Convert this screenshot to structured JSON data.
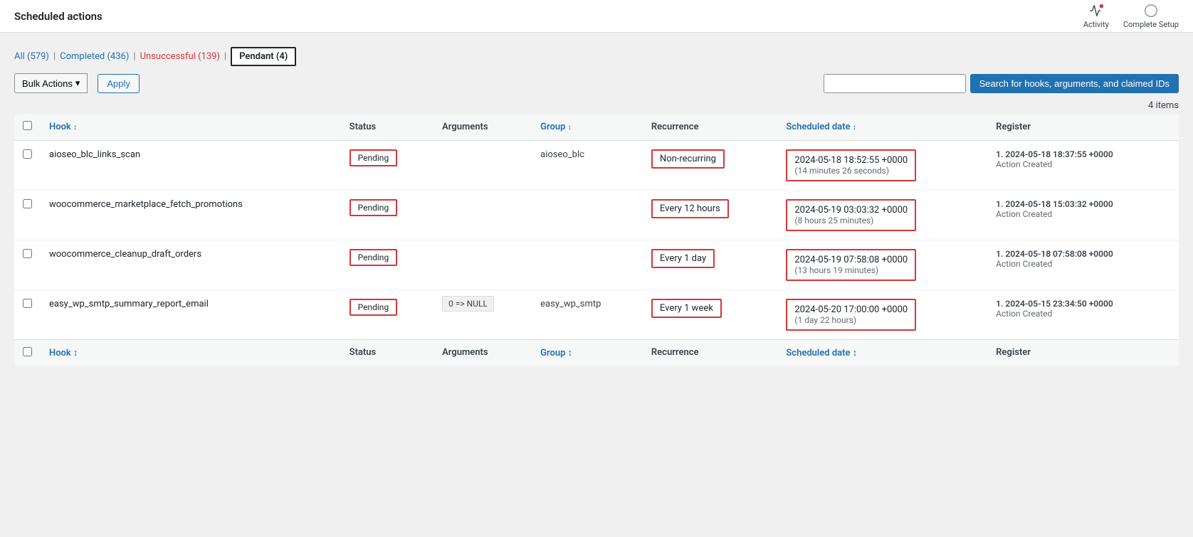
{
  "topbar": {
    "title": "Scheduled actions",
    "activity_label": "Activity",
    "complete_setup_label": "Complete Setup"
  },
  "tabs": {
    "all_label": "All",
    "all_count": "(579)",
    "completed_label": "Completed",
    "completed_count": "(436)",
    "unsuccessful_label": "Unsuccessful",
    "unsuccessful_count": "(139)",
    "pending_label": "Pendant",
    "pending_count": "(4)"
  },
  "toolbar": {
    "bulk_actions_label": "Bulk Actions",
    "apply_label": "Apply",
    "search_placeholder": "",
    "search_button_label": "Search for hooks, arguments, and claimed IDs",
    "items_count": "4 items"
  },
  "columns": {
    "hook": "Hook",
    "status": "Status",
    "arguments": "Arguments",
    "group": "Group",
    "recurrence": "Recurrence",
    "scheduled_date": "Scheduled date",
    "register": "Register"
  },
  "rows": [
    {
      "hook": "aioseo_blc_links_scan",
      "status": "Pending",
      "arguments": "",
      "group": "aioseo_blc",
      "recurrence": "Non-recurring",
      "scheduled_date_main": "2024-05-18 18:52:55 +0000",
      "scheduled_date_relative": "(14 minutes 26 seconds)",
      "register_num": "1.",
      "register_date": "2024-05-18 18:37:55 +0000",
      "register_label": "Action Created"
    },
    {
      "hook": "woocommerce_marketplace_fetch_promotions",
      "status": "Pending",
      "arguments": "",
      "group": "",
      "recurrence": "Every 12 hours",
      "scheduled_date_main": "2024-05-19 03:03:32 +0000",
      "scheduled_date_relative": "(8 hours 25 minutes)",
      "register_num": "1.",
      "register_date": "2024-05-18 15:03:32 +0000",
      "register_label": "Action Created"
    },
    {
      "hook": "woocommerce_cleanup_draft_orders",
      "status": "Pending",
      "arguments": "",
      "group": "",
      "recurrence": "Every 1 day",
      "scheduled_date_main": "2024-05-19 07:58:08 +0000",
      "scheduled_date_relative": "(13 hours 19 minutes)",
      "register_num": "1.",
      "register_date": "2024-05-18 07:58:08 +0000",
      "register_label": "Action Created"
    },
    {
      "hook": "easy_wp_smtp_summary_report_email",
      "status": "Pending",
      "arguments": "0 => NULL",
      "group": "easy_wp_smtp",
      "recurrence": "Every 1 week",
      "scheduled_date_main": "2024-05-20 17:00:00 +0000",
      "scheduled_date_relative": "(1 day 22 hours)",
      "register_num": "1.",
      "register_date": "2024-05-15 23:34:50 +0000",
      "register_label": "Action Created"
    }
  ]
}
